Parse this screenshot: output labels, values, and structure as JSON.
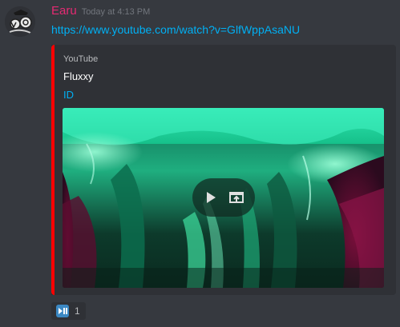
{
  "message": {
    "author": "Earu",
    "timestamp": "Today at 4:13 PM",
    "link": "https://www.youtube.com/watch?v=GlfWppAsaNU",
    "avatar_icon": "avatar-icon"
  },
  "embed": {
    "provider": "YouTube",
    "title": "Fluxxy",
    "author": "ID",
    "accent_color": "#ff0000",
    "video": {
      "play_icon": "play-icon",
      "popout_icon": "open-external-icon"
    }
  },
  "reaction": {
    "emoji_icon": "play-pause-button-icon",
    "count": "1"
  }
}
